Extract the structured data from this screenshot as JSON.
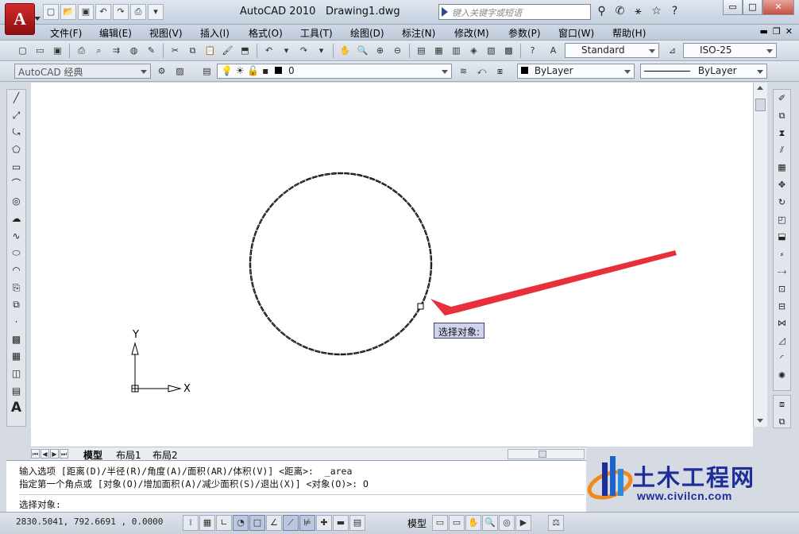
{
  "window": {
    "app_title": "AutoCAD 2010",
    "file_title": "Drawing1.dwg",
    "search_placeholder": "键入关键字或短语",
    "logo_letter": "A",
    "min_glyph": "▭",
    "restore_glyph": "□",
    "close_glyph": "✕"
  },
  "menubar": {
    "items": [
      "文件(F)",
      "编辑(E)",
      "视图(V)",
      "插入(I)",
      "格式(O)",
      "工具(T)",
      "绘图(D)",
      "标注(N)",
      "修改(M)",
      "参数(P)",
      "窗口(W)",
      "帮助(H)"
    ],
    "mdi_min": "▬",
    "mdi_restore": "❐",
    "mdi_close": "✕"
  },
  "toolbar1": {
    "text_style": "Standard",
    "dim_style": "ISO-25"
  },
  "toolbar2": {
    "workspace": "AutoCAD 经典",
    "layer": "0",
    "color": "ByLayer",
    "linetype": "ByLayer"
  },
  "drawing": {
    "ucs_x": "X",
    "ucs_y": "Y",
    "tooltip": "选择对象:"
  },
  "tabs": {
    "items": [
      "模型",
      "布局1",
      "布局2"
    ]
  },
  "command": {
    "line1": "输入选项 [距离(D)/半径(R)/角度(A)/面积(AR)/体积(V)] <距离>:  _area",
    "line2": "指定第一个角点或 [对象(O)/增加面积(A)/减少面积(S)/退出(X)] <对象(O)>: O",
    "prompt": "选择对象:"
  },
  "status": {
    "coords": "2830.5041, 792.6691 , 0.0000",
    "model": "模型"
  },
  "watermark": {
    "name": "土木工程网",
    "url": "www.civilcn.com"
  },
  "colors": {
    "arrow": "#e8303a",
    "tooltip_bg": "#cfd3ec",
    "watermark": "#1d2d99"
  }
}
